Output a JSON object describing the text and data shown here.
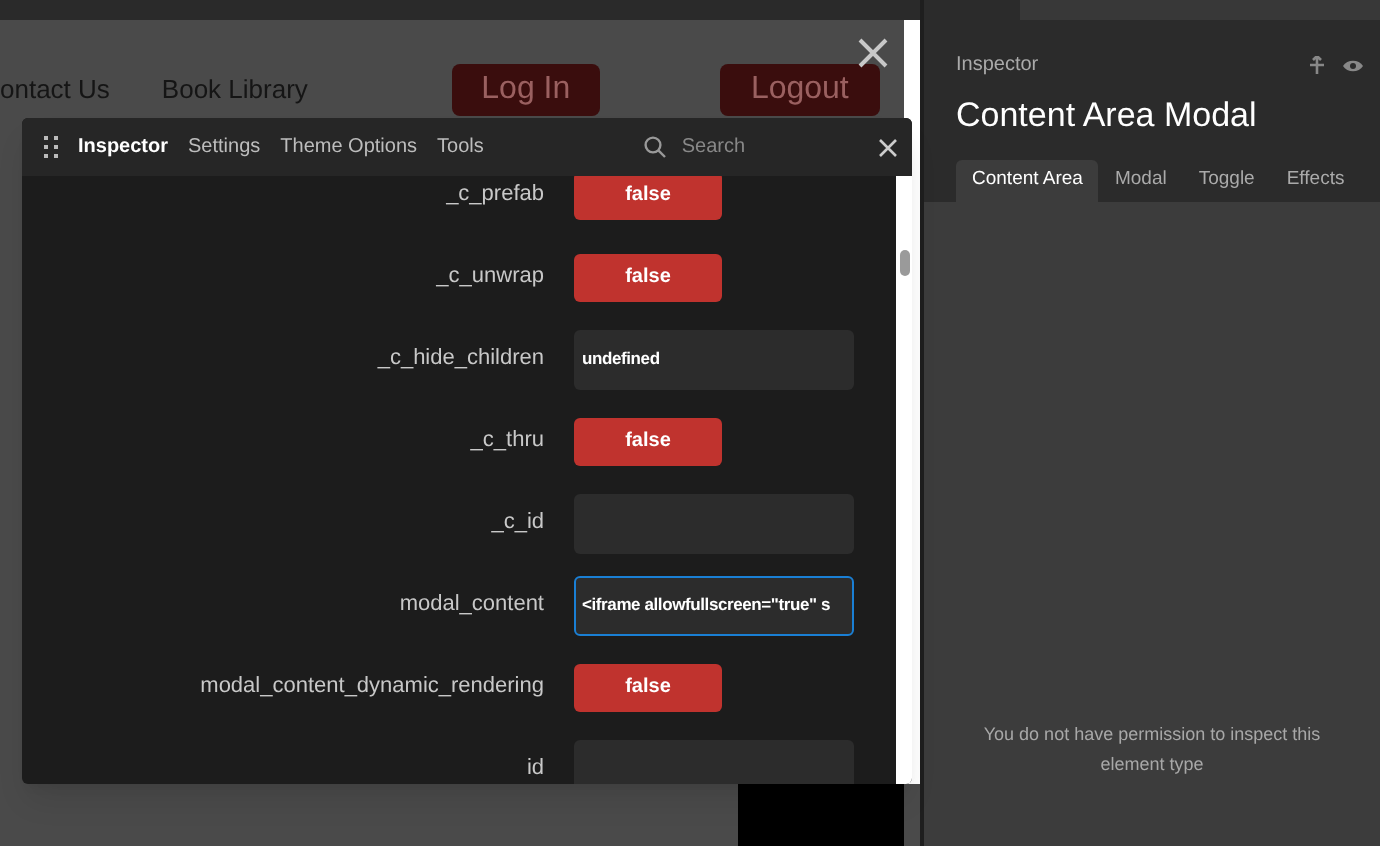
{
  "page": {
    "nav_links": [
      "ontact Us",
      "Book Library"
    ],
    "buttons": [
      "Log In",
      "Logout"
    ]
  },
  "inspector_window": {
    "tabs": [
      {
        "label": "Inspector",
        "selected": true
      },
      {
        "label": "Settings",
        "selected": false
      },
      {
        "label": "Theme Options",
        "selected": false
      },
      {
        "label": "Tools",
        "selected": false
      }
    ],
    "search": {
      "placeholder": "Search"
    },
    "properties": [
      {
        "label": "_c_prefab",
        "kind": "toggle",
        "value": "false"
      },
      {
        "label": "_c_unwrap",
        "kind": "toggle",
        "value": "false"
      },
      {
        "label": "_c_hide_children",
        "kind": "field",
        "value": "undefined",
        "focused": false
      },
      {
        "label": "_c_thru",
        "kind": "toggle",
        "value": "false"
      },
      {
        "label": "_c_id",
        "kind": "field",
        "focused": false
      },
      {
        "label": "modal_content",
        "kind": "field",
        "value": "<iframe allowfullscreen=\"true\" s",
        "focused": true
      },
      {
        "label": "modal_content_dynamic_rendering",
        "kind": "toggle",
        "value": "false"
      },
      {
        "label": "id",
        "kind": "field",
        "focused": false
      }
    ]
  },
  "side_panel": {
    "caption": "Inspector",
    "title": "Content Area Modal",
    "tabs": [
      {
        "label": "Content Area",
        "selected": true
      },
      {
        "label": "Modal",
        "selected": false
      },
      {
        "label": "Toggle",
        "selected": false
      },
      {
        "label": "Effects",
        "selected": false
      }
    ],
    "message": "You do not have permission to inspect this element type"
  }
}
